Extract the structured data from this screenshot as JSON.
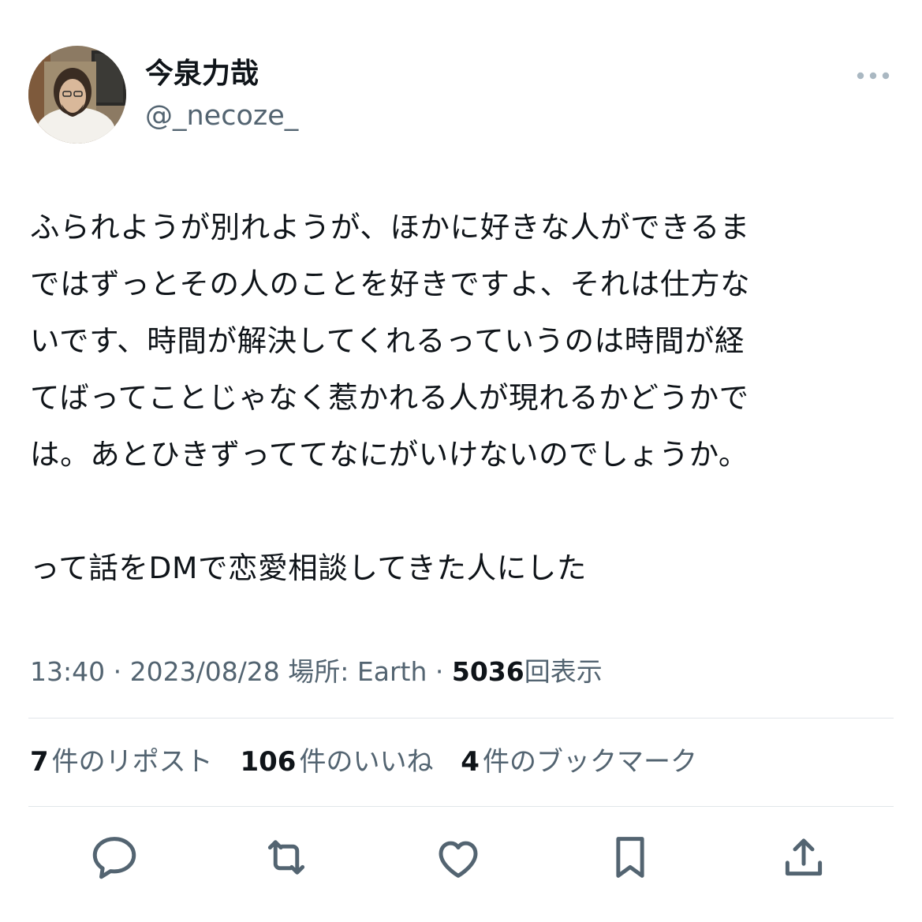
{
  "user": {
    "display_name": "今泉力哉",
    "handle": "@_necoze_"
  },
  "tweet": {
    "lines": [
      "ふられようが別れようが、ほかに好きな人ができるま",
      "ではずっとその人のことを好きですよ、それは仕方な",
      "いです、時間が解決してくれるっていうのは時間が経",
      "てばってことじゃなく惹かれる人が現れるかどうかで",
      "は。あとひきずっててなにがいけないのでしょうか。"
    ],
    "line_after": "って話をDMで恋愛相談してきた人にした"
  },
  "meta": {
    "time": "13:40",
    "sep1": " · ",
    "date": "2023/08/28",
    "location": " 場所: Earth",
    "sep2": " · ",
    "views_count": "5036",
    "views_label": "回表示"
  },
  "stats": {
    "reposts_count": "7",
    "reposts_label": "件のリポスト",
    "likes_count": "106",
    "likes_label": "件のいいね",
    "bookmarks_count": "4",
    "bookmarks_label": "件のブックマーク"
  },
  "icons": {
    "more": "more-horizontal-icon",
    "reply": "reply-icon",
    "repost": "repost-icon",
    "like": "heart-icon",
    "bookmark": "bookmark-icon",
    "share": "share-icon"
  },
  "colors": {
    "text": "#0f1419",
    "secondary": "#536471",
    "divider": "#e1e6ea",
    "more_dots": "#aab8c2"
  }
}
